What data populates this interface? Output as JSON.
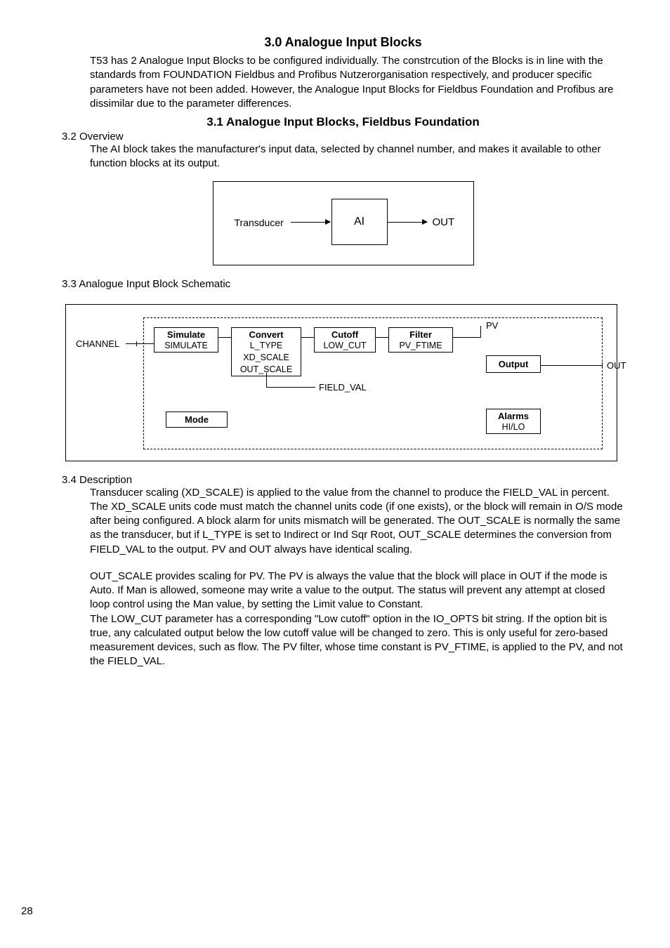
{
  "page_number": "28",
  "h_3_0": "3.0 Analogue Input Blocks",
  "p_3_0": "T53 has 2 Analogue Input Blocks to be configured individually. The constrcution of the Blocks is in line with the standards from FOUNDATION Fieldbus and Profibus Nutzerorganisation respectively, and producer specific parameters have not been added. However, the Analogue Input Blocks for Fieldbus Foundation and Profibus are dissimilar due to the parameter differences.",
  "h_3_1": "3.1 Analogue Input Blocks, Fieldbus Foundation",
  "s_3_2": "3.2 Overview",
  "p_3_2": "The AI block takes the manufacturer's input data, selected by channel number, and makes it available to other function blocks at its output.",
  "fig1": {
    "transducer": "Transducer",
    "ai": "AI",
    "out": "OUT"
  },
  "s_3_3": "3.3 Analogue Input Block Schematic",
  "fig2": {
    "channel": "CHANNEL",
    "sim_h": "Simulate",
    "sim_p": "SIMULATE",
    "conv_h": "Convert",
    "conv_p1": "L_TYPE",
    "conv_p2": "XD_SCALE",
    "conv_p3": "OUT_SCALE",
    "cut_h": "Cutoff",
    "cut_p": "LOW_CUT",
    "filt_h": "Filter",
    "filt_p": "PV_FTIME",
    "out_h": "Output",
    "mode_h": "Mode",
    "alarm_h": "Alarms",
    "alarm_p": "HI/LO",
    "pv": "PV",
    "field_val": "FIELD_VAL",
    "out_label": "OUT"
  },
  "s_3_4": "3.4  Description",
  "p_3_4a": "Transducer scaling (XD_SCALE) is applied to the value from the channel to produce the FIELD_VAL in percent. The XD_SCALE units code must match the channel units code (if one exists), or the block will remain in O/S mode after being configured. A block alarm for units mismatch will be generated. The OUT_SCALE is normally the same as the transducer, but if L_TYPE is set to Indirect or Ind Sqr Root, OUT_SCALE determines the conversion from FIELD_VAL to the output. PV and OUT always have identical scaling.",
  "p_3_4b": "OUT_SCALE provides scaling for PV. The PV is always the value that the block will place in OUT if the mode is Auto. If Man is allowed, someone may write a value to the output. The status will prevent any attempt at closed loop control using the Man value, by setting the Limit value to Constant.",
  "p_3_4c": "The LOW_CUT parameter has a corresponding \"Low cutoff\" option in the IO_OPTS bit string. If the option bit is true, any calculated output below the low cutoff value will be changed to zero. This is only useful for zero-based measurement devices, such as flow. The PV filter, whose time constant is PV_FTIME, is applied to the PV, and not the FIELD_VAL."
}
